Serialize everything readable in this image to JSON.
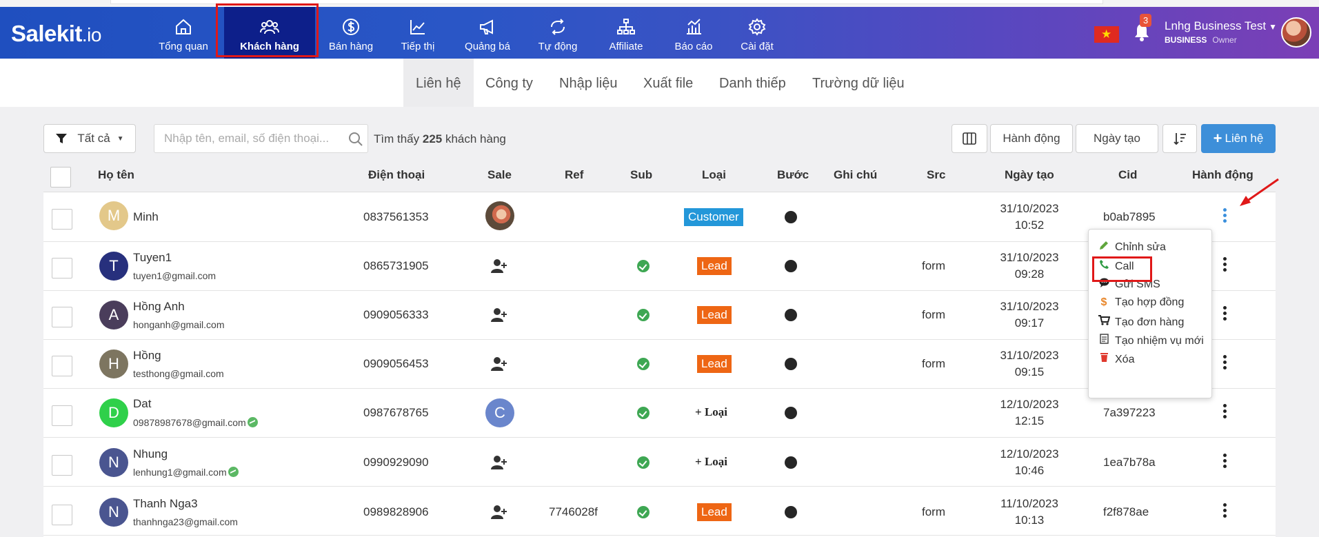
{
  "brand": {
    "name": "Salekit",
    "suffix": ".io"
  },
  "nav": [
    {
      "label": "Tổng quan",
      "icon": "home-icon"
    },
    {
      "label": "Khách hàng",
      "icon": "users-icon"
    },
    {
      "label": "Bán hàng",
      "icon": "dollar-icon"
    },
    {
      "label": "Tiếp thị",
      "icon": "chart-line-icon"
    },
    {
      "label": "Quảng bá",
      "icon": "megaphone-icon"
    },
    {
      "label": "Tự động",
      "icon": "sync-icon"
    },
    {
      "label": "Affiliate",
      "icon": "sitemap-icon"
    },
    {
      "label": "Báo cáo",
      "icon": "report-icon"
    },
    {
      "label": "Cài đặt",
      "icon": "gear-icon"
    }
  ],
  "header": {
    "notification_count": "3",
    "account_name": "Lnhg Business Test",
    "account_plan": "BUSINESS",
    "account_role": "Owner",
    "flag_color": "#e02a20"
  },
  "subtabs": [
    "Liên hệ",
    "Công ty",
    "Nhập liệu",
    "Xuất file",
    "Danh thiếp",
    "Trường dữ liệu"
  ],
  "toolbar": {
    "filter_label": "Tất cả",
    "search_placeholder": "Nhập tên, email, số điện thoại...",
    "found_prefix": "Tìm thấy",
    "found_count": "225",
    "found_suffix": "khách hàng",
    "action_label": "Hành động",
    "date_label": "Ngày tạo",
    "add_label": "Liên hệ"
  },
  "columns": [
    "Họ tên",
    "Điện thoại",
    "Sale",
    "Ref",
    "Sub",
    "Loại",
    "Bước",
    "Ghi chú",
    "Src",
    "Ngày tạo",
    "Cid",
    "Hành động"
  ],
  "rows": [
    {
      "initial": "M",
      "name": "Minh",
      "email": "",
      "phone": "0837561353",
      "ref": "",
      "type": "Customer",
      "src": "",
      "date": "31/10/2023",
      "time": "10:52",
      "cid": "b0ab7895"
    },
    {
      "initial": "T",
      "name": "Tuyen1",
      "email": "tuyen1@gmail.com",
      "phone": "0865731905",
      "ref": "",
      "type": "Lead",
      "src": "form",
      "date": "31/10/2023",
      "time": "09:28",
      "cid": ""
    },
    {
      "initial": "A",
      "name": "Hồng Anh",
      "email": "honganh@gmail.com",
      "phone": "0909056333",
      "ref": "",
      "type": "Lead",
      "src": "form",
      "date": "31/10/2023",
      "time": "09:17",
      "cid": ""
    },
    {
      "initial": "H",
      "name": "Hồng",
      "email": "testhong@gmail.com",
      "phone": "0909056453",
      "ref": "",
      "type": "Lead",
      "src": "form",
      "date": "31/10/2023",
      "time": "09:15",
      "cid": ""
    },
    {
      "initial": "D",
      "name": "Dat",
      "email": "09878987678@gmail.com",
      "phone": "0987678765",
      "ref": "",
      "type": "Loại",
      "src": "",
      "date": "12/10/2023",
      "time": "12:15",
      "cid": "7a397223"
    },
    {
      "initial": "N",
      "name": "Nhung",
      "email": "lenhung1@gmail.com",
      "phone": "0990929090",
      "ref": "",
      "type": "Loại",
      "src": "",
      "date": "12/10/2023",
      "time": "10:46",
      "cid": "1ea7b78a"
    },
    {
      "initial": "N",
      "name": "Thanh Nga3",
      "email": "thanhnga23@gmail.com",
      "phone": "0989828906",
      "ref": "7746028f",
      "type": "Lead",
      "src": "form",
      "date": "11/10/2023",
      "time": "10:13",
      "cid": "f2f878ae"
    }
  ],
  "sale_c_initial": "C",
  "dropdown": [
    {
      "label": "Chỉnh sửa",
      "icon": "pencil-icon"
    },
    {
      "label": "Call",
      "icon": "phone-icon"
    },
    {
      "label": "Gửi SMS",
      "icon": "sms-icon"
    },
    {
      "label": "Tạo hợp đồng",
      "icon": "dollar-sign-icon"
    },
    {
      "label": "Tạo đơn hàng",
      "icon": "cart-icon"
    },
    {
      "label": "Tạo nhiệm vụ mới",
      "icon": "task-icon"
    },
    {
      "label": "Xóa",
      "icon": "trash-icon"
    }
  ],
  "colors": {
    "accent": "#3d8fd9",
    "customer": "#2397d9",
    "lead": "#ee6614",
    "highlight": "#e01818",
    "nav_active": "#0d1f8a"
  }
}
